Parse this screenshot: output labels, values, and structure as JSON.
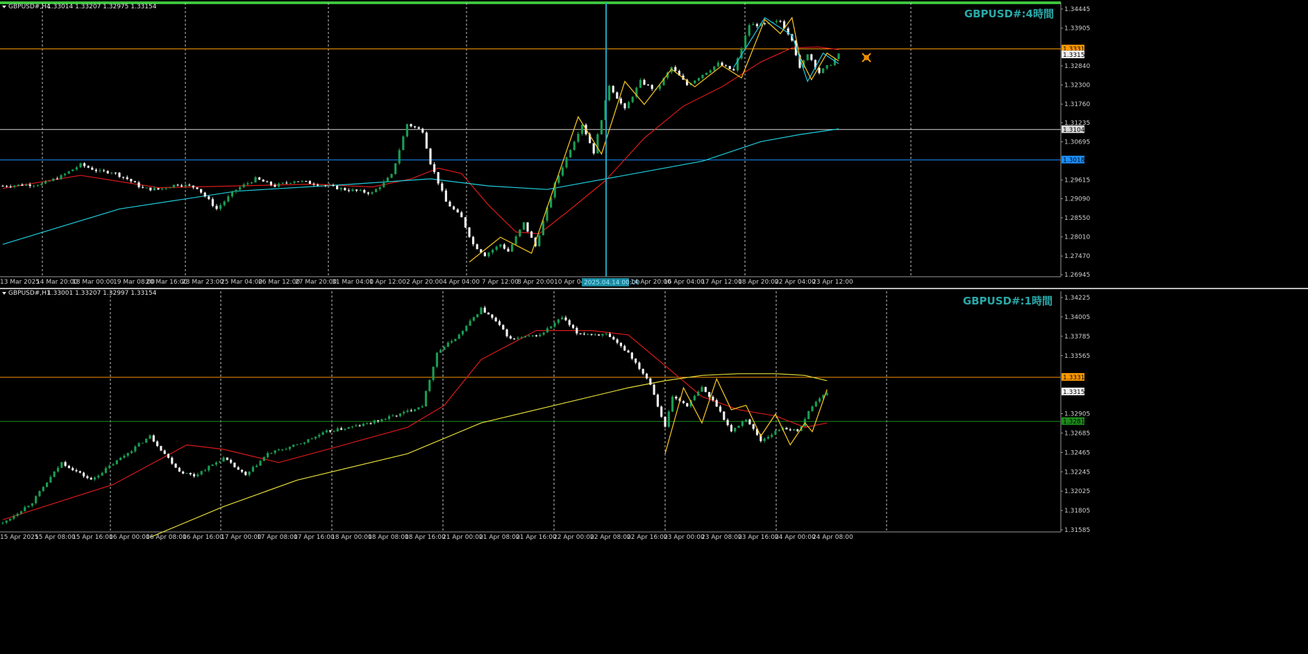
{
  "window": {
    "accent": "#3cc43c"
  },
  "panels": [
    {
      "id": "h4",
      "info_label": "GBPUSD#,H4",
      "ohlc": "1.33014 1.33207 1.32975 1.33154",
      "watermark": "GBPUSD#:4時間",
      "price_axis": [
        "1.34445",
        "1.33905",
        "1.32840",
        "1.32300",
        "1.31760",
        "1.31235",
        "1.30695",
        "1.29615",
        "1.29090",
        "1.28550",
        "1.28010",
        "1.27470",
        "1.26945"
      ],
      "price_range": [
        1.26945,
        1.34445
      ],
      "time_axis": [
        "13 Mar 2025",
        "14 Mar 20:00",
        "18 Mar 00:00",
        "19 Mar 08:00",
        "20 Mar 16:00",
        "23 Mar 23:00",
        "25 Mar 04:00",
        "26 Mar 12:00",
        "27 Mar 20:00",
        "31 Mar 04:00",
        "1 Apr 12:00",
        "2 Apr 20:00",
        "4 Apr 04:00",
        "7 Apr 12:00",
        "8 Apr 20:00",
        "10 Apr 04:00",
        "14 Apr 20:00",
        "16 Apr 04:00",
        "17 Apr 12:00",
        "18 Apr 20:00",
        "22 Apr 04:00",
        "23 Apr 12:00"
      ],
      "crosshair_time": "2025.04.14 00:00",
      "current_price": "1.33154",
      "hlines": [
        {
          "price": 1.33319,
          "label": "1.33319",
          "color": "#ff9900"
        },
        {
          "price": 1.31042,
          "label": "1.31042",
          "color": "#d8d8d8"
        },
        {
          "price": 1.30184,
          "label": "1.30184",
          "color": "#1e90ff"
        }
      ]
    },
    {
      "id": "h1",
      "info_label": "GBPUSD#,H1",
      "ohlc": "1.33001 1.33207 1.32997 1.33154",
      "watermark": "GBPUSD#:1時間",
      "price_axis": [
        "1.34225",
        "1.34005",
        "1.33785",
        "1.33565",
        "1.32905",
        "1.32685",
        "1.32465",
        "1.32245",
        "1.32025",
        "1.31805",
        "1.31585"
      ],
      "price_range": [
        1.31585,
        1.34225
      ],
      "time_axis": [
        "15 Apr 2025",
        "15 Apr 08:00",
        "15 Apr 16:00",
        "16 Apr 00:00",
        "16 Apr 08:00",
        "16 Apr 16:00",
        "17 Apr 00:00",
        "17 Apr 08:00",
        "17 Apr 16:00",
        "18 Apr 00:00",
        "18 Apr 08:00",
        "18 Apr 16:00",
        "21 Apr 00:00",
        "21 Apr 08:00",
        "21 Apr 16:00",
        "22 Apr 00:00",
        "22 Apr 08:00",
        "22 Apr 16:00",
        "23 Apr 00:00",
        "23 Apr 08:00",
        "23 Apr 16:00",
        "24 Apr 00:00",
        "24 Apr 08:00"
      ],
      "current_price": "1.33154",
      "hlines": [
        {
          "price": 1.33319,
          "label": "1.33319",
          "color": "#ff9900"
        },
        {
          "price": 1.32817,
          "label": "1.32817",
          "color": "#1c8c1c"
        }
      ]
    }
  ],
  "chart_data": [
    {
      "type": "candlestick",
      "title": "GBPUSD#:4時間",
      "ylim": [
        1.26945,
        1.34445
      ],
      "close_path": [
        [
          0,
          1.2945
        ],
        [
          5,
          1.2948
        ],
        [
          10,
          1.295
        ],
        [
          15,
          1.2972
        ],
        [
          20,
          1.3005
        ],
        [
          25,
          1.2985
        ],
        [
          28,
          1.2985
        ],
        [
          32,
          1.2965
        ],
        [
          36,
          1.2938
        ],
        [
          40,
          1.2935
        ],
        [
          45,
          1.295
        ],
        [
          50,
          1.294
        ],
        [
          55,
          1.288
        ],
        [
          60,
          1.2935
        ],
        [
          65,
          1.2965
        ],
        [
          70,
          1.2945
        ],
        [
          75,
          1.296
        ],
        [
          80,
          1.2952
        ],
        [
          88,
          1.2935
        ],
        [
          95,
          1.2925
        ],
        [
          100,
          1.2975
        ],
        [
          104,
          1.312
        ],
        [
          108,
          1.31
        ],
        [
          110,
          1.301
        ],
        [
          114,
          1.29
        ],
        [
          118,
          1.2855
        ],
        [
          121,
          1.278
        ],
        [
          124,
          1.275
        ],
        [
          128,
          1.278
        ],
        [
          130,
          1.276
        ],
        [
          134,
          1.284
        ],
        [
          137,
          1.2775
        ],
        [
          142,
          1.295
        ],
        [
          146,
          1.305
        ],
        [
          149,
          1.312
        ],
        [
          152,
          1.304
        ],
        [
          156,
          1.323
        ],
        [
          160,
          1.316
        ],
        [
          164,
          1.324
        ],
        [
          168,
          1.3215
        ],
        [
          172,
          1.328
        ],
        [
          176,
          1.323
        ],
        [
          180,
          1.326
        ],
        [
          184,
          1.329
        ],
        [
          188,
          1.327
        ],
        [
          192,
          1.34
        ],
        [
          196,
          1.34
        ],
        [
          200,
          1.341
        ],
        [
          203,
          1.336
        ],
        [
          205,
          1.3275
        ],
        [
          207,
          1.332
        ],
        [
          210,
          1.3265
        ],
        [
          213,
          1.329
        ],
        [
          215,
          1.3315
        ]
      ],
      "moving_averages": [
        {
          "color": "#dd1a1a",
          "values": [
            [
              0,
              1.2938
            ],
            [
              20,
              1.2975
            ],
            [
              40,
              1.294
            ],
            [
              60,
              1.2945
            ],
            [
              80,
              1.295
            ],
            [
              95,
              1.2942
            ],
            [
              105,
              1.2965
            ],
            [
              112,
              1.2995
            ],
            [
              118,
              1.298
            ],
            [
              125,
              1.289
            ],
            [
              132,
              1.2815
            ],
            [
              138,
              1.281
            ],
            [
              145,
              1.287
            ],
            [
              155,
              1.296
            ],
            [
              165,
              1.308
            ],
            [
              175,
              1.317
            ],
            [
              185,
              1.3225
            ],
            [
              195,
              1.3295
            ],
            [
              203,
              1.3335
            ],
            [
              210,
              1.3337
            ],
            [
              215,
              1.333
            ]
          ]
        },
        {
          "color": "#1fd0e0",
          "values": [
            [
              0,
              1.278
            ],
            [
              30,
              1.288
            ],
            [
              60,
              1.293
            ],
            [
              90,
              1.295
            ],
            [
              110,
              1.2965
            ],
            [
              125,
              1.2945
            ],
            [
              140,
              1.2935
            ],
            [
              160,
              1.2975
            ],
            [
              180,
              1.3015
            ],
            [
              195,
              1.307
            ],
            [
              205,
              1.309
            ],
            [
              215,
              1.3106
            ]
          ]
        }
      ],
      "zigzag_yellow": [
        [
          120,
          1.273
        ],
        [
          128,
          1.28
        ],
        [
          136,
          1.2755
        ],
        [
          148,
          1.314
        ],
        [
          154,
          1.3035
        ],
        [
          160,
          1.324
        ],
        [
          165,
          1.3175
        ],
        [
          172,
          1.3275
        ],
        [
          178,
          1.3225
        ],
        [
          185,
          1.3285
        ],
        [
          190,
          1.325
        ],
        [
          196,
          1.3415
        ],
        [
          200,
          1.3375
        ],
        [
          203,
          1.342
        ],
        [
          205,
          1.331
        ],
        [
          208,
          1.3245
        ],
        [
          212,
          1.332
        ],
        [
          215,
          1.3298
        ]
      ],
      "zigzag_cyan": [
        [
          188,
          1.328
        ],
        [
          196,
          1.342
        ],
        [
          203,
          1.337
        ],
        [
          207,
          1.324
        ],
        [
          211,
          1.332
        ],
        [
          215,
          1.329
        ]
      ],
      "hlines": [
        1.33319,
        1.31042,
        1.30184
      ],
      "current_price": 1.33154
    },
    {
      "type": "candlestick",
      "title": "GBPUSD#:1時間",
      "ylim": [
        1.31585,
        1.34225
      ],
      "close_path": [
        [
          0,
          1.3166
        ],
        [
          8,
          1.319
        ],
        [
          16,
          1.3235
        ],
        [
          24,
          1.3215
        ],
        [
          32,
          1.324
        ],
        [
          40,
          1.3265
        ],
        [
          48,
          1.3225
        ],
        [
          52,
          1.322
        ],
        [
          60,
          1.324
        ],
        [
          66,
          1.322
        ],
        [
          72,
          1.3245
        ],
        [
          80,
          1.3255
        ],
        [
          88,
          1.327
        ],
        [
          98,
          1.3278
        ],
        [
          108,
          1.329
        ],
        [
          114,
          1.33
        ],
        [
          118,
          1.336
        ],
        [
          124,
          1.338
        ],
        [
          130,
          1.341
        ],
        [
          134,
          1.3395
        ],
        [
          138,
          1.3375
        ],
        [
          146,
          1.338
        ],
        [
          152,
          1.34
        ],
        [
          156,
          1.3382
        ],
        [
          164,
          1.338
        ],
        [
          170,
          1.336
        ],
        [
          176,
          1.3325
        ],
        [
          180,
          1.3275
        ],
        [
          182,
          1.331
        ],
        [
          186,
          1.33
        ],
        [
          190,
          1.332
        ],
        [
          194,
          1.33
        ],
        [
          198,
          1.327
        ],
        [
          202,
          1.3285
        ],
        [
          206,
          1.326
        ],
        [
          212,
          1.3275
        ],
        [
          216,
          1.327
        ],
        [
          220,
          1.33
        ],
        [
          224,
          1.3315
        ]
      ],
      "moving_averages": [
        {
          "color": "#dd1a1a",
          "values": [
            [
              0,
              1.317
            ],
            [
              30,
              1.321
            ],
            [
              50,
              1.3255
            ],
            [
              60,
              1.325
            ],
            [
              75,
              1.3235
            ],
            [
              90,
              1.3252
            ],
            [
              110,
              1.3275
            ],
            [
              120,
              1.33
            ],
            [
              130,
              1.3352
            ],
            [
              145,
              1.3385
            ],
            [
              160,
              1.3385
            ],
            [
              170,
              1.338
            ],
            [
              180,
              1.3345
            ],
            [
              190,
              1.331
            ],
            [
              200,
              1.3295
            ],
            [
              210,
              1.3288
            ],
            [
              218,
              1.3275
            ],
            [
              224,
              1.328
            ]
          ]
        },
        {
          "color": "#e8e03a",
          "values": [
            [
              40,
              1.315
            ],
            [
              60,
              1.3185
            ],
            [
              80,
              1.3215
            ],
            [
              110,
              1.3245
            ],
            [
              130,
              1.328
            ],
            [
              150,
              1.33
            ],
            [
              170,
              1.332
            ],
            [
              180,
              1.3328
            ],
            [
              190,
              1.3334
            ],
            [
              200,
              1.3336
            ],
            [
              210,
              1.3336
            ],
            [
              218,
              1.3334
            ],
            [
              224,
              1.3328
            ]
          ]
        }
      ],
      "zigzag_yellow": [
        [
          180,
          1.3245
        ],
        [
          185,
          1.332
        ],
        [
          190,
          1.328
        ],
        [
          194,
          1.333
        ],
        [
          198,
          1.3295
        ],
        [
          202,
          1.33
        ],
        [
          206,
          1.3265
        ],
        [
          210,
          1.329
        ],
        [
          214,
          1.3255
        ],
        [
          218,
          1.328
        ],
        [
          220,
          1.327
        ],
        [
          224,
          1.3318
        ]
      ],
      "hlines": [
        1.33319,
        1.32817
      ],
      "current_price": 1.33154
    }
  ]
}
